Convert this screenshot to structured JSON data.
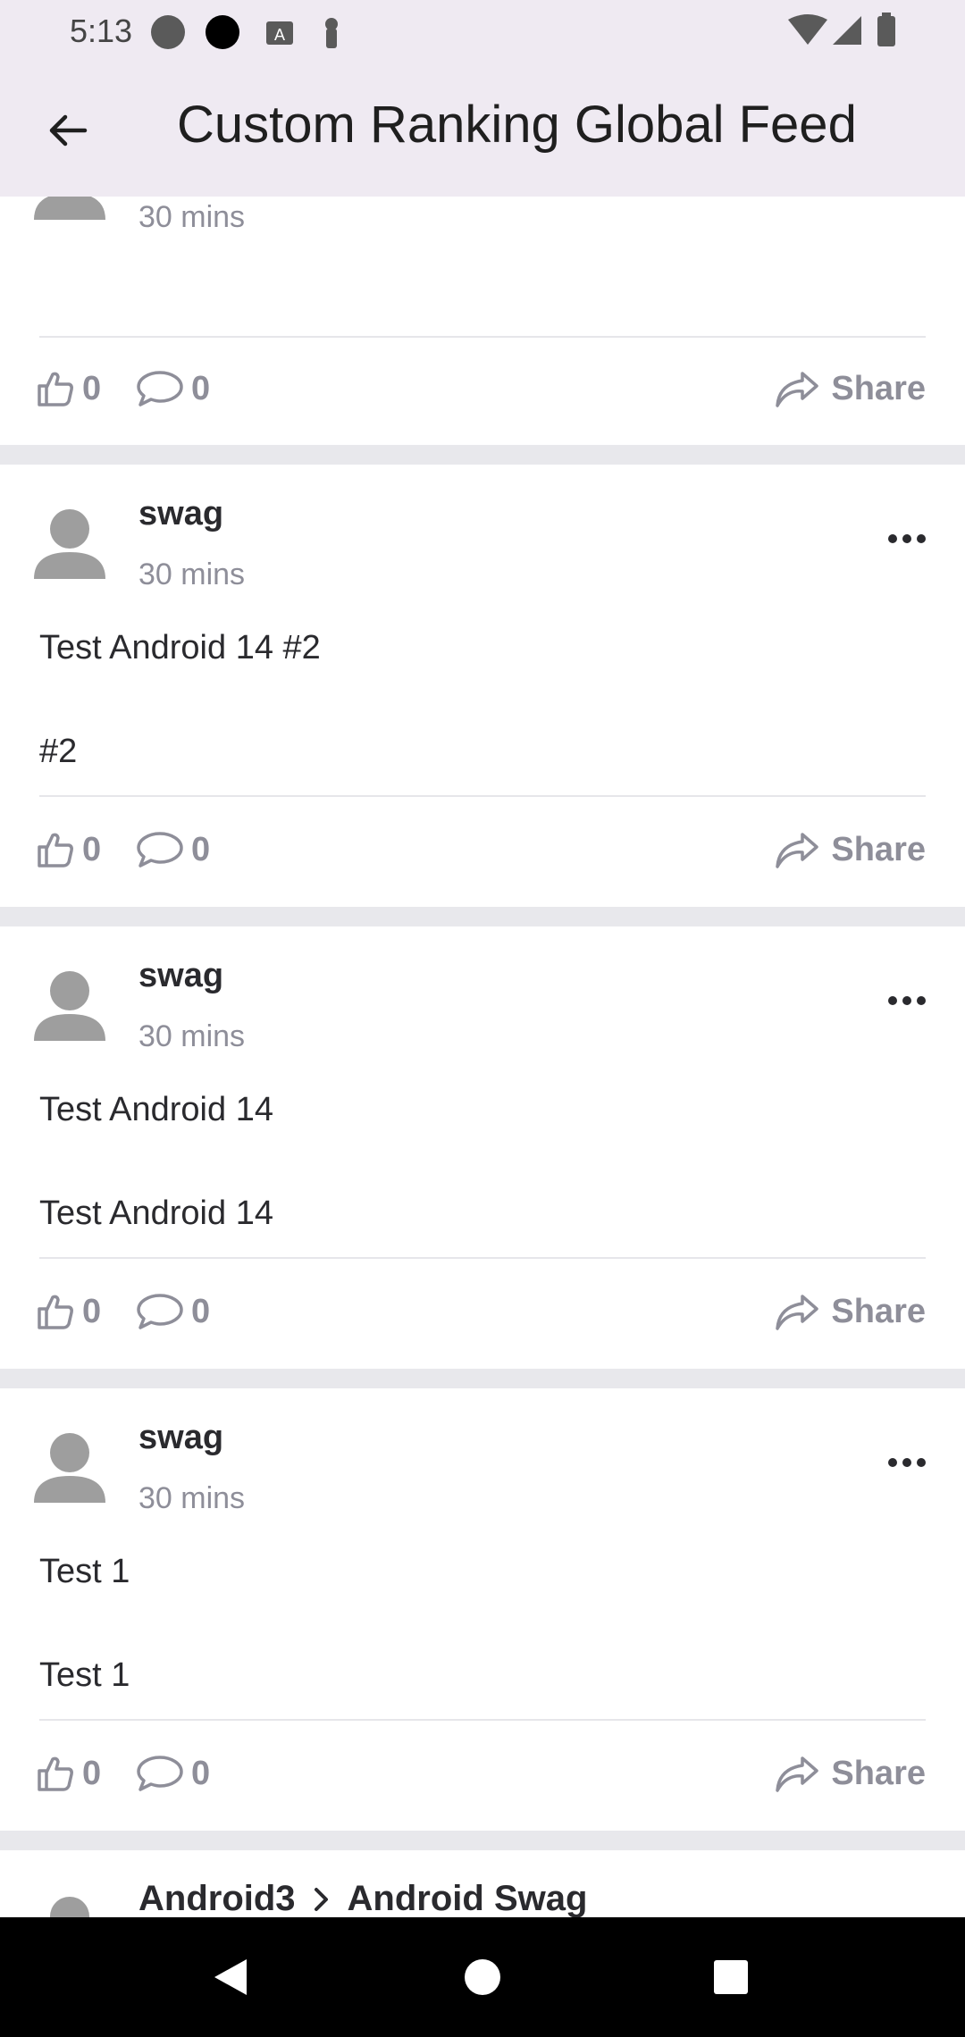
{
  "status_bar": {
    "time": "5:13"
  },
  "app_bar": {
    "title": "Custom Ranking Global Feed"
  },
  "posts": [
    {
      "time": "30 mins",
      "likes": "0",
      "comments": "0",
      "share_label": "Share"
    },
    {
      "author": "swag",
      "time": "30 mins",
      "title": "Test Android 14 #2",
      "body": "#2",
      "likes": "0",
      "comments": "0",
      "share_label": "Share"
    },
    {
      "author": "swag",
      "time": "30 mins",
      "title": "Test Android 14",
      "body": "Test Android 14",
      "likes": "0",
      "comments": "0",
      "share_label": "Share"
    },
    {
      "author": "swag",
      "time": "30 mins",
      "title": "Test 1",
      "body": "Test 1",
      "likes": "0",
      "comments": "0",
      "share_label": "Share"
    },
    {
      "author": "Android3",
      "community": "Android Swag"
    }
  ],
  "colors": {
    "accent": "#8e8e99",
    "text": "#2a2a2e",
    "bar": "#efeaf2",
    "separator": "#e8e8ec"
  },
  "icons": [
    "back-arrow-icon",
    "thumbs-up-icon",
    "comment-icon",
    "share-arrow-icon",
    "more-dots-icon",
    "avatar-icon",
    "chevron-right-icon"
  ]
}
